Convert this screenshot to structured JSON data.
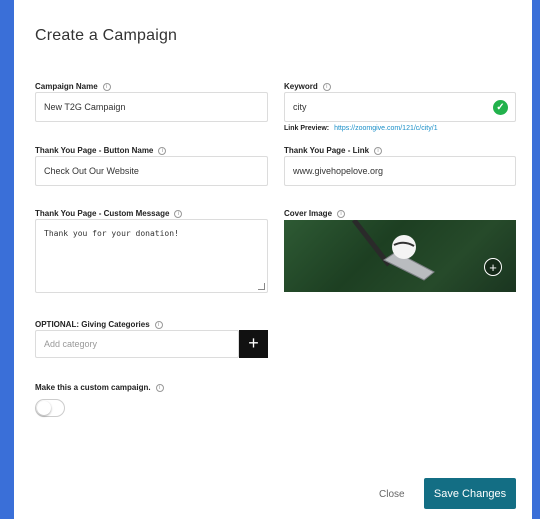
{
  "modal": {
    "title": "Create a Campaign"
  },
  "form": {
    "campaign_name": {
      "label": "Campaign Name",
      "value": "New T2G Campaign"
    },
    "keyword": {
      "label": "Keyword",
      "value": "city"
    },
    "link_preview": {
      "label": "Link Preview:",
      "url": "https://zoomgive.com/121/c/city/1"
    },
    "ty_button_name": {
      "label": "Thank You Page - Button Name",
      "value": "Check Out Our Website"
    },
    "ty_link": {
      "label": "Thank You Page - Link",
      "value": "www.givehopelove.org"
    },
    "ty_message": {
      "label": "Thank You Page - Custom Message",
      "value": "Thank you for your donation!"
    },
    "cover_image": {
      "label": "Cover Image"
    },
    "giving_categories": {
      "label": "OPTIONAL: Giving Categories",
      "placeholder": "Add category"
    },
    "custom_campaign": {
      "label": "Make this a custom campaign.",
      "enabled": false
    }
  },
  "footer": {
    "close_label": "Close",
    "save_label": "Save Changes"
  },
  "colors": {
    "backdrop": "#3a6fd8",
    "primary_button": "#136e84",
    "success": "#22b24c",
    "link": "#1a8fc8"
  },
  "icons": {
    "info": "info-icon",
    "check": "check-circle-icon",
    "plus": "plus-icon"
  }
}
